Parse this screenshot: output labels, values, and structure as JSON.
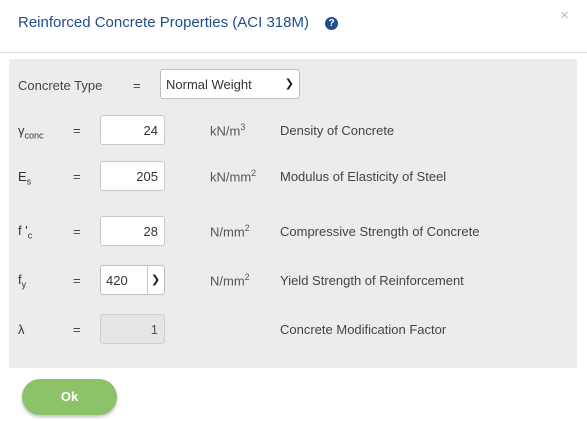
{
  "dialog": {
    "title": "Reinforced Concrete Properties (ACI 318M)",
    "help_icon": "?",
    "close_icon": "×"
  },
  "concrete_type": {
    "label": "Concrete Type",
    "equals": "=",
    "selected": "Normal Weight"
  },
  "rows": [
    {
      "symbol": "γ",
      "symbol_sub": "conc",
      "symbol_sup": "",
      "equals": "=",
      "value": "24",
      "unit": "kN/m",
      "unit_sup": "3",
      "description": "Density of Concrete"
    },
    {
      "symbol": "E",
      "symbol_sub": "s",
      "symbol_sup": "",
      "equals": "=",
      "value": "205",
      "unit": "kN/mm",
      "unit_sup": "2",
      "description": "Modulus of Elasticity of Steel"
    },
    {
      "symbol": "f '",
      "symbol_sub": "c",
      "symbol_sup": "",
      "equals": "=",
      "value": "28",
      "unit": "N/mm",
      "unit_sup": "2",
      "description": "Compressive Strength of Concrete"
    },
    {
      "symbol": "f",
      "symbol_sub": "y",
      "symbol_sup": "",
      "equals": "=",
      "value": "420",
      "unit": "N/mm",
      "unit_sup": "2",
      "description": "Yield Strength of Reinforcement"
    },
    {
      "symbol": "λ",
      "symbol_sub": "",
      "symbol_sup": "",
      "equals": "=",
      "value": "1",
      "unit": "",
      "unit_sup": "",
      "description": "Concrete Modification Factor"
    }
  ],
  "ok_button": {
    "label": "Ok"
  },
  "colors": {
    "title": "#1f4e8c",
    "ok_button": "#8cc36a",
    "panel": "#ececec"
  }
}
